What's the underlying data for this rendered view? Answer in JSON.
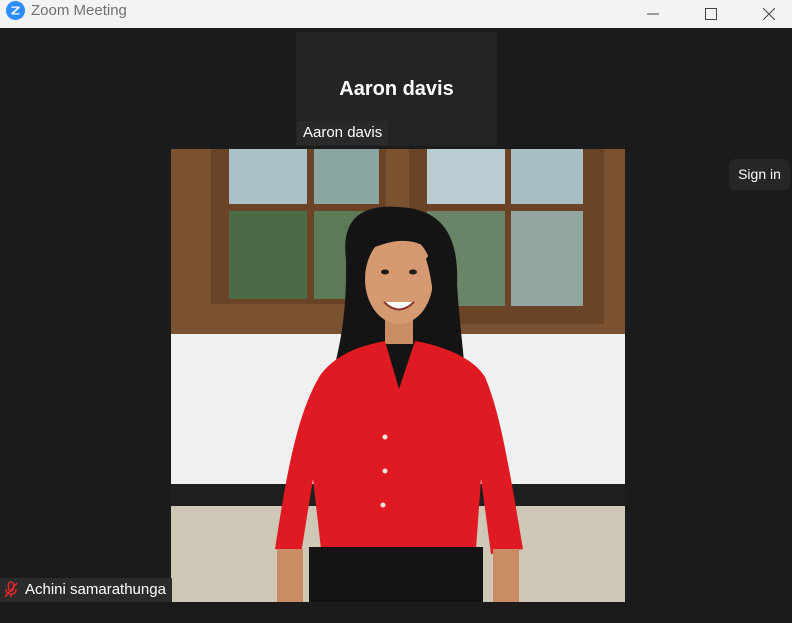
{
  "window": {
    "title": "Zoom Meeting",
    "logo_icon": "zoom-logo-icon",
    "controls": [
      "minimize-icon",
      "maximize-icon",
      "close-icon"
    ]
  },
  "meeting": {
    "active_speaker": {
      "display_name": "Aaron davis",
      "name_tag": "Aaron davis"
    },
    "sign_in_label": "Sign in",
    "participant_video": {
      "name": "Achini samarathunga",
      "mic_status_icon": "mic-muted-icon"
    }
  },
  "colors": {
    "stage_background": "#1b1b1b",
    "titlebar_background": "#f3f3f3",
    "zoom_blue": "#2d8cff",
    "muted_red": "#e02828"
  }
}
